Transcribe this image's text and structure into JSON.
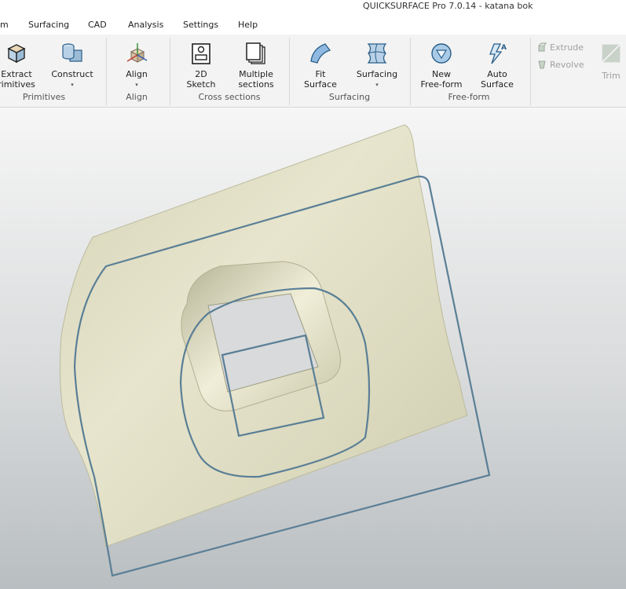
{
  "window": {
    "title": "QUICKSURFACE Pro 7.0.14 - katana bok"
  },
  "menu": {
    "items": [
      {
        "label": "m"
      },
      {
        "label": "Surfacing"
      },
      {
        "label": "CAD"
      },
      {
        "label": "Analysis"
      },
      {
        "label": "Settings"
      },
      {
        "label": "Help"
      }
    ]
  },
  "ribbon": {
    "groups": {
      "primitives": {
        "label": "Primitives",
        "tools": {
          "extract": {
            "line1": "Extract",
            "line2": "rimitives",
            "icon": "cube-icon"
          },
          "construct": {
            "label": "Construct",
            "caret": "▾",
            "icon": "cylinder-box-icon"
          }
        }
      },
      "align": {
        "label": "Align",
        "tools": {
          "align": {
            "label": "Align",
            "caret": "▾",
            "icon": "axes-cube-icon"
          }
        }
      },
      "cross_sections": {
        "label": "Cross sections",
        "tools": {
          "sketch": {
            "line1": "2D",
            "line2": "Sketch",
            "icon": "sketch-icon"
          },
          "multiple": {
            "line1": "Multiple",
            "line2": "sections",
            "icon": "pages-icon"
          }
        }
      },
      "surfacing": {
        "label": "Surfacing",
        "tools": {
          "fit": {
            "line1": "Fit",
            "line2": "Surface",
            "icon": "fit-surface-icon"
          },
          "surfacing": {
            "label": "Surfacing",
            "caret": "▾",
            "icon": "surface-patch-icon"
          }
        }
      },
      "freeform": {
        "label": "Free-form",
        "tools": {
          "new": {
            "line1": "New",
            "line2": "Free-form",
            "icon": "freeform-ball-icon"
          },
          "auto": {
            "line1": "Auto",
            "line2": "Surface",
            "icon": "auto-surface-icon"
          }
        }
      },
      "cad_ops": {
        "tools": {
          "extrude": {
            "label": "Extrude",
            "icon": "extrude-icon"
          },
          "revolve": {
            "label": "Revolve",
            "icon": "revolve-icon"
          },
          "trim": {
            "label": "Trim",
            "icon": "trim-icon"
          }
        }
      }
    }
  },
  "colors": {
    "accent_blue": "#3a86c8",
    "mesh_fill": "#dcdac0",
    "curve_stroke": "#5a7f96",
    "viewport_top": "#f6f6f6",
    "viewport_bottom": "#b9bec1"
  }
}
